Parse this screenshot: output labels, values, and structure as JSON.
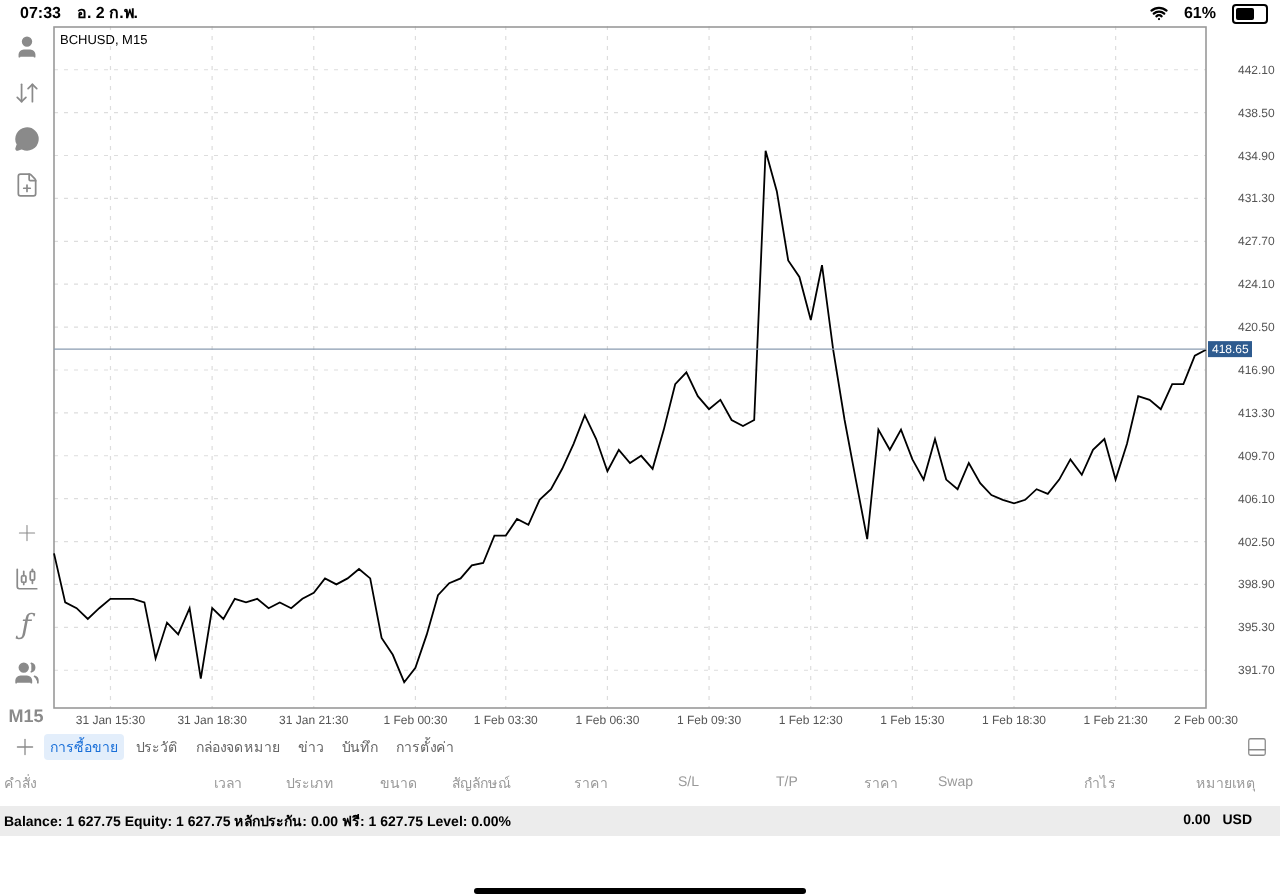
{
  "status_bar": {
    "time": "07:33",
    "date": "อ. 2 ก.พ.",
    "battery": "61%"
  },
  "toolbar": {
    "top": [
      {
        "kind": "account"
      },
      {
        "kind": "trade"
      },
      {
        "kind": "chat"
      },
      {
        "kind": "new-order"
      }
    ],
    "bottom": [
      {
        "kind": "crosshair"
      },
      {
        "kind": "candles"
      },
      {
        "kind": "function",
        "glyph": "ƒ"
      },
      {
        "kind": "objects"
      }
    ],
    "timeframe": "M15"
  },
  "chart": {
    "title": "BCHUSD, M15",
    "chart_data": {
      "type": "line",
      "grid": true,
      "categories": [
        null,
        null,
        null,
        null,
        null,
        "31 Jan 15:30",
        null,
        null,
        null,
        null,
        null,
        null,
        null,
        null,
        "31 Jan 18:30",
        null,
        null,
        null,
        null,
        null,
        null,
        null,
        null,
        "31 Jan 21:30",
        null,
        null,
        null,
        null,
        null,
        null,
        null,
        null,
        "1 Feb 00:30",
        null,
        null,
        null,
        null,
        null,
        null,
        null,
        "1 Feb 03:30",
        null,
        null,
        null,
        null,
        null,
        null,
        null,
        null,
        "1 Feb 06:30",
        null,
        null,
        null,
        null,
        null,
        null,
        null,
        null,
        "1 Feb 09:30",
        null,
        null,
        null,
        null,
        null,
        null,
        null,
        null,
        "1 Feb 12:30",
        null,
        null,
        null,
        null,
        null,
        null,
        null,
        null,
        "1 Feb 15:30",
        null,
        null,
        null,
        null,
        null,
        null,
        null,
        null,
        "1 Feb 18:30",
        null,
        null,
        null,
        null,
        null,
        null,
        null,
        null,
        "1 Feb 21:30",
        null,
        null,
        null,
        null,
        null,
        null,
        null,
        "2 Feb 00:30"
      ],
      "series": [
        {
          "color": "#000000",
          "values": [
            401.5,
            397.4,
            396.9,
            396.0,
            396.9,
            397.7,
            397.7,
            397.7,
            397.4,
            392.7,
            395.7,
            394.7,
            396.9,
            391.0,
            396.9,
            396.0,
            397.7,
            397.4,
            397.7,
            396.9,
            397.4,
            396.9,
            397.7,
            398.2,
            399.4,
            398.9,
            399.4,
            400.2,
            399.4,
            394.4,
            393.0,
            390.7,
            391.9,
            394.7,
            398.0,
            399.0,
            399.4,
            400.5,
            400.7,
            403.0,
            403.0,
            404.4,
            403.9,
            406.0,
            406.9,
            408.6,
            410.7,
            413.1,
            411.1,
            408.4,
            410.2,
            409.1,
            409.7,
            408.6,
            411.9,
            415.7,
            416.7,
            414.7,
            413.6,
            414.4,
            412.7,
            412.2,
            412.7,
            435.3,
            431.9,
            426.1,
            424.7,
            421.1,
            425.7,
            418.6,
            412.7,
            407.7,
            402.7,
            411.9,
            410.2,
            411.9,
            409.4,
            407.7,
            411.1,
            407.7,
            406.9,
            409.1,
            407.4,
            406.4,
            406.0,
            405.7,
            406.0,
            406.9,
            406.5,
            407.7,
            409.4,
            408.1,
            410.2,
            411.1,
            407.7,
            410.7,
            414.7,
            414.4,
            413.6,
            415.7,
            415.7,
            418.1,
            418.6
          ]
        }
      ],
      "ylim": [
        388.53,
        445.77
      ],
      "yticks": [
        {
          "value": 391.7,
          "label": "391.70"
        },
        {
          "value": 395.3,
          "label": "395.30"
        },
        {
          "value": 398.9,
          "label": "398.90"
        },
        {
          "value": 402.5,
          "label": "402.50"
        },
        {
          "value": 406.1,
          "label": "406.10"
        },
        {
          "value": 409.7,
          "label": "409.70"
        },
        {
          "value": 413.3,
          "label": "413.30"
        },
        {
          "value": 416.9,
          "label": "416.90"
        },
        {
          "value": 420.5,
          "label": "420.50"
        },
        {
          "value": 424.1,
          "label": "424.10"
        },
        {
          "value": 427.7,
          "label": "427.70"
        },
        {
          "value": 431.3,
          "label": "431.30"
        },
        {
          "value": 434.9,
          "label": "434.90"
        },
        {
          "value": 438.5,
          "label": "438.50"
        },
        {
          "value": 442.1,
          "label": "442.10"
        }
      ],
      "ref_lines": [
        {
          "axis": "y",
          "value": 418.65,
          "label": "418.65"
        }
      ]
    }
  },
  "tabs": [
    {
      "label": "การซื้อขาย",
      "selected": true
    },
    {
      "label": "ประวัติ",
      "selected": false
    },
    {
      "label": "กล่องจดหมาย",
      "selected": false
    },
    {
      "label": "ข่าว",
      "selected": false
    },
    {
      "label": "บันทึก",
      "selected": false
    },
    {
      "label": "การตั้งค่า",
      "selected": false
    }
  ],
  "table": {
    "columns": [
      "คำสั่ง",
      "เวลา",
      "ประเภท",
      "ขนาด",
      "สัญลักษณ์",
      "ราคา",
      "S/L",
      "T/P",
      "ราคา",
      "Swap",
      "กำไร",
      "หมายเหตุ"
    ]
  },
  "summary": {
    "text": "Balance: 1 627.75 Equity: 1 627.75 หลักประกัน: 0.00 ฟรี: 1 627.75 Level: 0.00%",
    "profit": "0.00",
    "currency": "USD"
  }
}
